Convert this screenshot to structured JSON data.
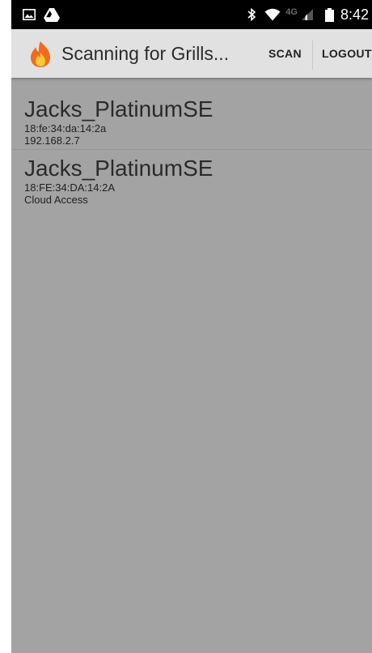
{
  "status_bar": {
    "time": "8:42",
    "network_label": "4G",
    "icons": [
      "image-icon",
      "drive-icon",
      "bluetooth-icon",
      "wifi-icon",
      "signal-icon",
      "battery-icon"
    ]
  },
  "app_bar": {
    "title": "Scanning for Grills...",
    "logo": "flame-logo-icon",
    "actions": {
      "scan": "SCAN",
      "logout": "LOGOUT"
    }
  },
  "devices": [
    {
      "name": "Jacks_PlatinumSE",
      "mac": "18:fe:34:da:14:2a",
      "detail": "192.168.2.7"
    },
    {
      "name": "Jacks_PlatinumSE",
      "mac": "18:FE:34:DA:14:2A",
      "detail": "Cloud Access"
    }
  ],
  "colors": {
    "status_bar": "#000000",
    "app_bar": "#e1e1e1",
    "list_background": "#a3a3a3",
    "flame_orange": "#f26a1b",
    "flame_yellow": "#fcc63a"
  }
}
